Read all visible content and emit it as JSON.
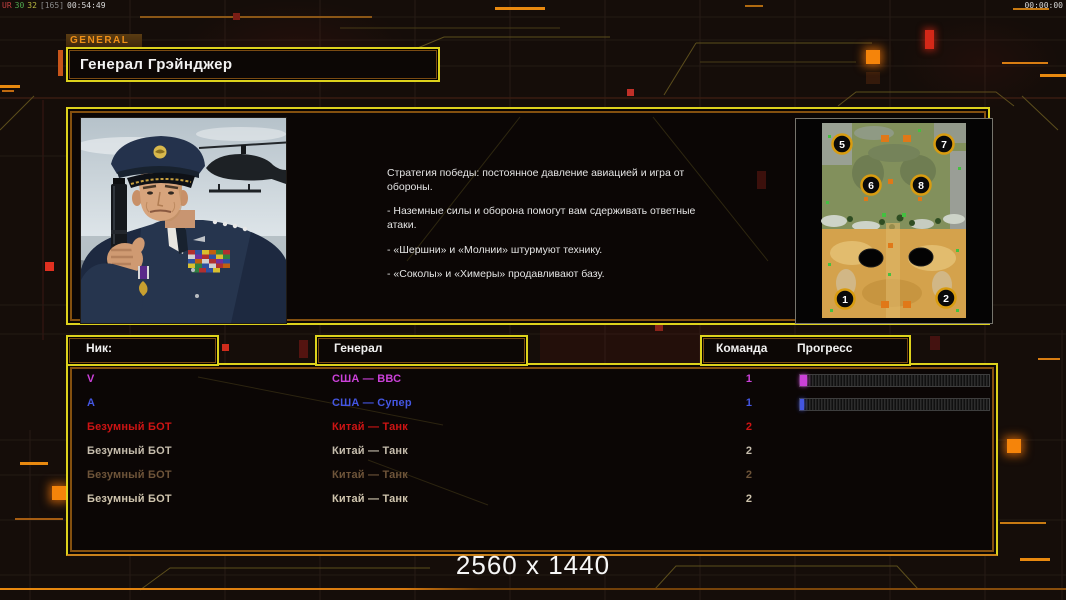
{
  "hud": {
    "debug": {
      "a": "UR",
      "b": "30",
      "c": "32",
      "d": "[165]",
      "e": "00:54:49"
    },
    "clock": "00:00:00"
  },
  "tab": {
    "label": "GENERAL"
  },
  "title": {
    "text": "Генерал Грэйнджер"
  },
  "briefing": {
    "paragraphs": [
      "Стратегия победы: постоянное давление авиацией и игра от обороны.",
      "- Наземные силы и оборона помогут вам сдерживать ответные атаки.",
      "- «Шершни» и «Молнии» штурмуют технику.",
      "- «Соколы» и «Химеры» продавливают базу."
    ]
  },
  "map_preview": {
    "start_positions": [
      "5",
      "7",
      "6",
      "8",
      "1",
      "2"
    ]
  },
  "roster": {
    "headers": {
      "nick": "Ник:",
      "general": "Генерал",
      "team": "Команда",
      "progress": "Прогресс"
    },
    "rows": [
      {
        "nick": "V",
        "general": "США — ВВС",
        "team": "1",
        "color": "#cb41d9",
        "has_progress_bar": true,
        "progress_percent": 4
      },
      {
        "nick": "A",
        "general": "США — Супер",
        "team": "1",
        "color": "#4456e2",
        "has_progress_bar": true,
        "progress_percent": 2
      },
      {
        "nick": "Безумный БОТ",
        "general": "Китай — Танк",
        "team": "2",
        "color": "#ce1414",
        "has_progress_bar": false,
        "progress_percent": 0
      },
      {
        "nick": "Безумный БОТ",
        "general": "Китай — Танк",
        "team": "2",
        "color": "#c6bdad",
        "has_progress_bar": false,
        "progress_percent": 0
      },
      {
        "nick": "Безумный БОТ",
        "general": "Китай — Танк",
        "team": "2",
        "color": "#6e5439",
        "has_progress_bar": false,
        "progress_percent": 0
      },
      {
        "nick": "Безумный БОТ",
        "general": "Китай — Танк",
        "team": "2",
        "color": "#d0c5ae",
        "has_progress_bar": false,
        "progress_percent": 0
      }
    ]
  },
  "footer": {
    "resolution_label": "2560 x 1440"
  },
  "colors": {
    "accent_yellow": "#ddd21c",
    "accent_orange": "#e8890f",
    "panel_inner_orange": "#84500f",
    "debug_red": "#c04040",
    "debug_green": "#50a850",
    "debug_yellow": "#b8b840",
    "debug_gray": "#8a8a8a"
  }
}
